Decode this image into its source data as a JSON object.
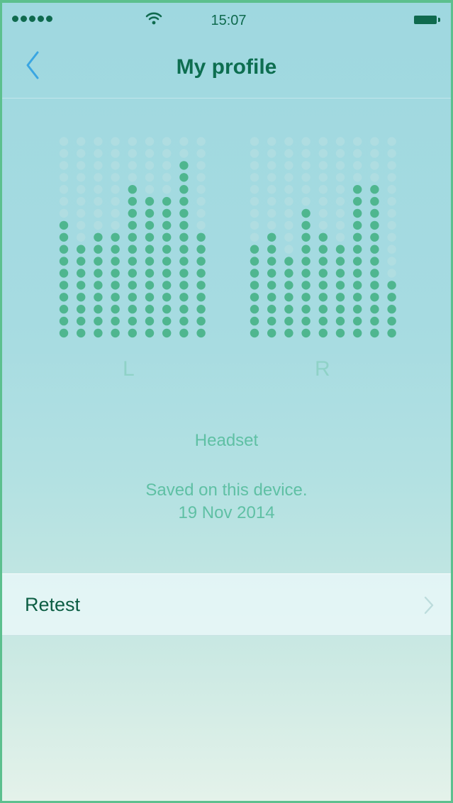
{
  "status_bar": {
    "time": "15:07",
    "signal_icon": "signal-dots-icon",
    "wifi_icon": "wifi-icon",
    "battery_icon": "battery-icon"
  },
  "nav": {
    "title": "My profile",
    "back_icon": "chevron-left-icon"
  },
  "audiogram": {
    "levels_max": 17,
    "left": {
      "label": "L",
      "levels": [
        10,
        8,
        9,
        9,
        13,
        12,
        12,
        15,
        9
      ]
    },
    "right": {
      "label": "R",
      "levels": [
        8,
        9,
        7,
        11,
        9,
        8,
        13,
        13,
        5
      ]
    },
    "colors": {
      "active": "#4fb68f",
      "inactive": "#b9e0e2"
    }
  },
  "profile": {
    "device": "Headset",
    "saved_text": "Saved on this device.",
    "saved_date": "19 Nov 2014"
  },
  "retest": {
    "label": "Retest",
    "chevron_icon": "chevron-right-icon"
  }
}
